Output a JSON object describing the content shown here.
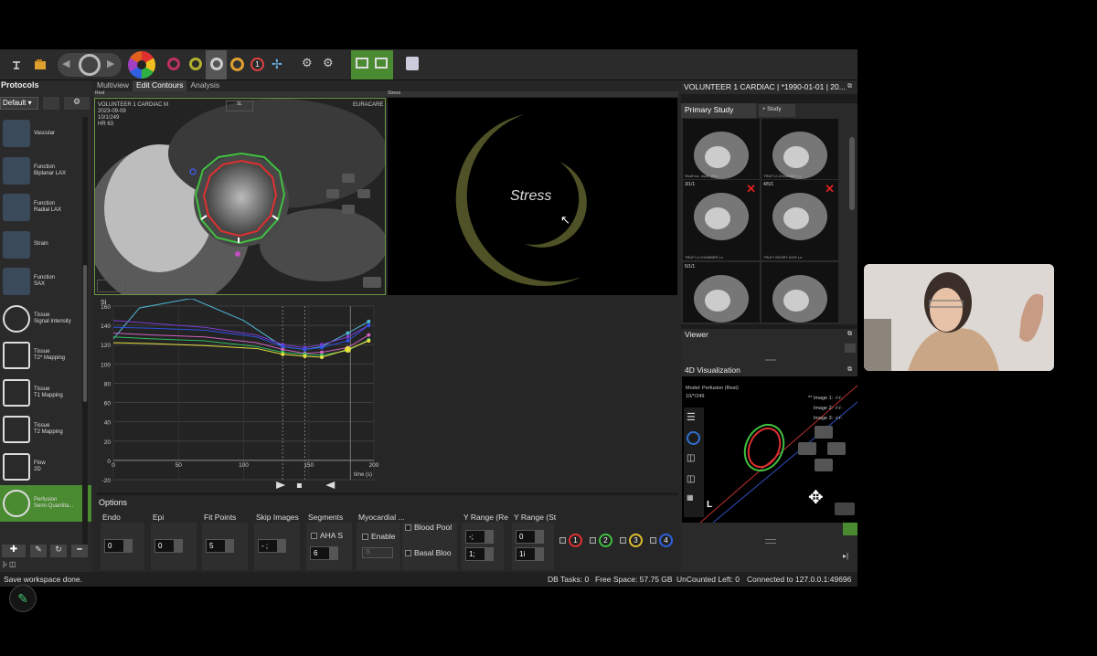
{
  "tabs": [
    {
      "label": "Multiview"
    },
    {
      "label": "Edit Contours"
    },
    {
      "label": "Analysis"
    }
  ],
  "protocols": {
    "header": "Protocols",
    "dropdown": "Default",
    "items": [
      {
        "label": "Vascular"
      },
      {
        "label": "Function\nBiplanar LAX"
      },
      {
        "label": "Function\nRadial LAX"
      },
      {
        "label": "Strain"
      },
      {
        "label": "Function\nSAX"
      },
      {
        "label": "Tissue\nSignal Intensity"
      },
      {
        "label": "Tissue\nT2* Mapping"
      },
      {
        "label": "Tissue\nT1 Mapping"
      },
      {
        "label": "Tissue\nT2 Mapping"
      },
      {
        "label": "Flow\n2D"
      },
      {
        "label": "Perfusion\nSemi-Quantita..."
      }
    ]
  },
  "viewports": {
    "rest_label": "Rest",
    "stress_label": "Stress",
    "patient": "VOLUNTEER 1 CARDIAC  M",
    "date": "2023-09-09",
    "frame": "10/1/249",
    "hr": "HR 63",
    "site": "EURACARE",
    "orient_top": "SL",
    "stress_text": "Stress"
  },
  "chart": {
    "ylabel": "SI",
    "xlabel": "time (s)",
    "yticks": [
      "160",
      "140",
      "120",
      "100",
      "80",
      "60",
      "40",
      "20",
      "0",
      "-20"
    ],
    "xticks": [
      "0",
      "50",
      "100",
      "150",
      "200"
    ]
  },
  "chart_data": {
    "type": "line",
    "ylabel": "SI",
    "xlabel": "time (s)",
    "ylim": [
      -20,
      160
    ],
    "xlim": [
      0,
      200
    ],
    "series": [
      {
        "color": "#4fb8d8",
        "x": [
          0,
          20,
          60,
          100,
          130,
          147,
          160,
          180,
          196
        ],
        "y": [
          126,
          158,
          168,
          145,
          118,
          115,
          118,
          132,
          144
        ]
      },
      {
        "color": "#7a3cd0",
        "x": [
          0,
          30,
          70,
          110,
          130,
          147,
          160,
          180,
          196
        ],
        "y": [
          145,
          142,
          138,
          130,
          120,
          117,
          120,
          128,
          140
        ]
      },
      {
        "color": "#3050e0",
        "x": [
          0,
          30,
          70,
          110,
          130,
          147,
          160,
          180,
          196
        ],
        "y": [
          138,
          137,
          135,
          128,
          118,
          115,
          117,
          124,
          140
        ]
      },
      {
        "color": "#d060c0",
        "x": [
          0,
          30,
          70,
          110,
          130,
          147,
          160,
          180,
          196
        ],
        "y": [
          132,
          130,
          128,
          122,
          115,
          111,
          112,
          117,
          130
        ]
      },
      {
        "color": "#30c060",
        "x": [
          0,
          30,
          70,
          110,
          130,
          147,
          160,
          180,
          196
        ],
        "y": [
          128,
          126,
          124,
          118,
          112,
          110,
          109,
          114,
          125
        ]
      },
      {
        "color": "#e8e040",
        "x": [
          0,
          30,
          70,
          110,
          130,
          147,
          160,
          180,
          196
        ],
        "y": [
          122,
          121,
          119,
          116,
          110,
          108,
          107,
          115,
          124
        ]
      }
    ]
  },
  "options": {
    "title": "Options",
    "columns": [
      {
        "label": "Endo",
        "value": "0"
      },
      {
        "label": "Epi",
        "value": "0"
      },
      {
        "label": "Fit Points",
        "value": "5"
      },
      {
        "label": "Skip Images",
        "value": "- ;"
      },
      {
        "label": "Segments",
        "check": "AHA S",
        "value": "6"
      },
      {
        "label": "Myocardial ...",
        "check": "Enable",
        "value": "S"
      },
      {
        "check1": "Blood Pool",
        "check2": "Basal Bloo"
      },
      {
        "label": "Y Range (Re",
        "v1": "-;",
        "v2": "1;"
      },
      {
        "label": "Y Range (St",
        "v1": "0",
        "v2": "1i"
      }
    ],
    "series_buttons": [
      "1",
      "2",
      "3",
      "4"
    ]
  },
  "status": {
    "left": "Save workspace done.",
    "db": "DB Tasks: 0",
    "free": "Free Space: 57.75 GB",
    "uncounted": "UnCounted Left: 0",
    "connected": "Connected to 127.0.0.1:49696"
  },
  "right": {
    "title": "VOLUNTEER 1 CARDIAC | *1990-01-01 | 20...",
    "primary": "Primary Study",
    "add_study": "+ Study",
    "thumbs": [
      {
        "cap": "Shuff loc. multi. (PAY"
      },
      {
        "cap": "TRUFI 2-CHAMBER Lo"
      },
      {
        "num": "3/1/1",
        "cap": "TRUFI 4-CHAMBER Lo"
      },
      {
        "num": "4/5/1",
        "cap": "TRUFI SHORT AXIS Lo"
      },
      {
        "num": "5/1/1",
        "cap": ""
      },
      {
        "num": "",
        "cap": ""
      }
    ],
    "viewer": "Viewer",
    "viz": "4D Visualization",
    "model": "Model: Perfusion (Rest)",
    "model_frame": "10/*/249",
    "image1": "** Image 1: -/-/-",
    "image2": "Image 2: -/-/-",
    "image3": "Image 3: -/-/-"
  },
  "colors": {
    "accent": "#4a8a30",
    "bg": "#262626",
    "endo": "#e03030",
    "epi": "#40c040"
  }
}
